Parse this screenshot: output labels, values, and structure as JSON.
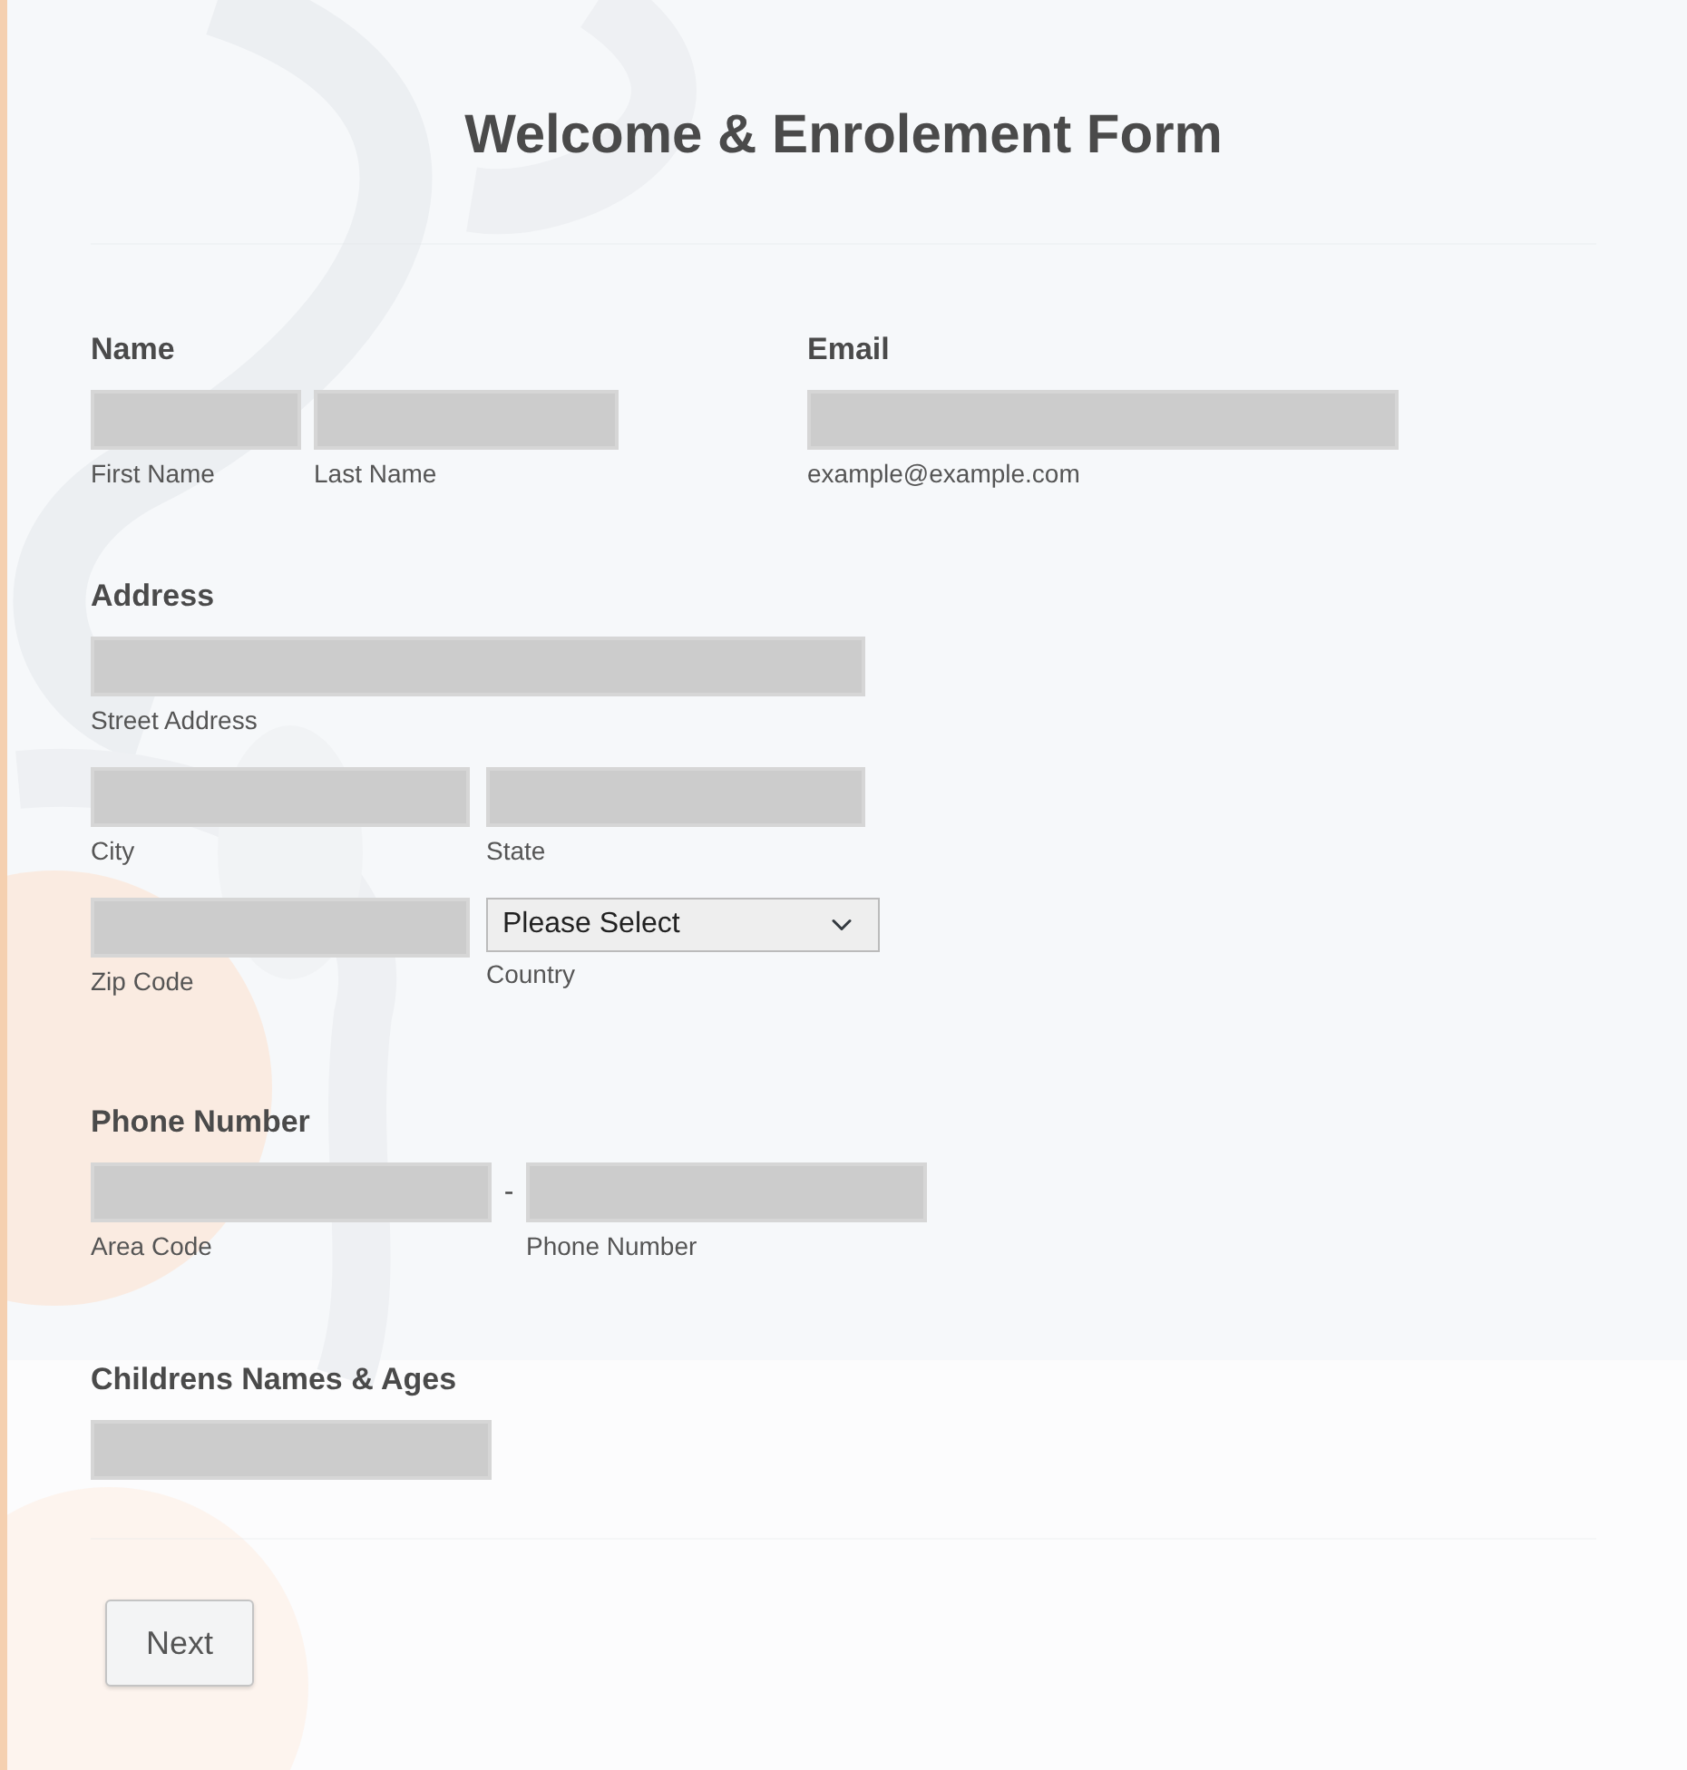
{
  "title": "Welcome & Enrolement Form",
  "name_field": {
    "label": "Name",
    "parts": [
      {
        "sublabel": "First Name"
      },
      {
        "sublabel": "Last Name"
      }
    ]
  },
  "email_field": {
    "label": "Email",
    "sublabel": "example@example.com"
  },
  "address_field": {
    "label": "Address",
    "street": {
      "sublabel": "Street Address"
    },
    "city": {
      "sublabel": "City"
    },
    "state": {
      "sublabel": "State"
    },
    "zip": {
      "sublabel": "Zip Code"
    },
    "country": {
      "value": "Please Select",
      "sublabel": "Country"
    }
  },
  "phone_field": {
    "label": "Phone Number",
    "separator": "-",
    "area": {
      "sublabel": "Area Code"
    },
    "number": {
      "sublabel": "Phone Number"
    }
  },
  "children_field": {
    "label": "Childrens Names & Ages"
  },
  "buttons": [
    {
      "label": "Next"
    }
  ]
}
